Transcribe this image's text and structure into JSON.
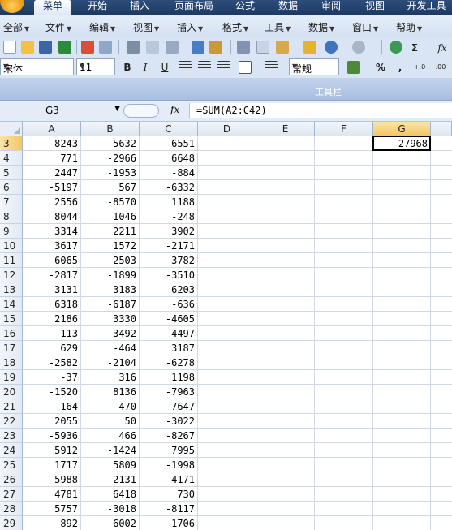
{
  "ribbon_tabs": [
    "菜单",
    "开始",
    "插入",
    "页面布局",
    "公式",
    "数据",
    "审阅",
    "视图",
    "开发工具"
  ],
  "menu_items": [
    "全部",
    "文件",
    "编辑",
    "视图",
    "插入",
    "格式",
    "工具",
    "数据",
    "窗口",
    "帮助"
  ],
  "toolbar": {
    "font_name": "宋体",
    "font_size": "11",
    "number_format": "常规",
    "bold": "B",
    "italic": "I",
    "underline": "U",
    "sum_symbol": "Σ",
    "percent": "%",
    "comma": ",",
    "increase_decimal": "+.0",
    "decrease_decimal": ".00",
    "fx_button": "fx"
  },
  "toolbar_caption": "工具栏",
  "formula_bar": {
    "name_box": "G3",
    "fx_label": "fx",
    "formula": "=SUM(A2:C42)"
  },
  "columns": [
    "A",
    "B",
    "C",
    "D",
    "E",
    "F",
    "G"
  ],
  "selected_column": "G",
  "selected_row": "3",
  "rows": [
    {
      "row": "3",
      "a": "8243",
      "b": "-5632",
      "c": "-6551",
      "g": "27968"
    },
    {
      "row": "4",
      "a": "771",
      "b": "-2966",
      "c": "6648",
      "g": ""
    },
    {
      "row": "5",
      "a": "2447",
      "b": "-1953",
      "c": "-884",
      "g": ""
    },
    {
      "row": "6",
      "a": "-5197",
      "b": "567",
      "c": "-6332",
      "g": ""
    },
    {
      "row": "7",
      "a": "2556",
      "b": "-8570",
      "c": "1188",
      "g": ""
    },
    {
      "row": "8",
      "a": "8044",
      "b": "1046",
      "c": "-248",
      "g": ""
    },
    {
      "row": "9",
      "a": "3314",
      "b": "2211",
      "c": "3902",
      "g": ""
    },
    {
      "row": "10",
      "a": "3617",
      "b": "1572",
      "c": "-2171",
      "g": ""
    },
    {
      "row": "11",
      "a": "6065",
      "b": "-2503",
      "c": "-3782",
      "g": ""
    },
    {
      "row": "12",
      "a": "-2817",
      "b": "-1899",
      "c": "-3510",
      "g": ""
    },
    {
      "row": "13",
      "a": "3131",
      "b": "3183",
      "c": "6203",
      "g": ""
    },
    {
      "row": "14",
      "a": "6318",
      "b": "-6187",
      "c": "-636",
      "g": ""
    },
    {
      "row": "15",
      "a": "2186",
      "b": "3330",
      "c": "-4605",
      "g": ""
    },
    {
      "row": "16",
      "a": "-113",
      "b": "3492",
      "c": "4497",
      "g": ""
    },
    {
      "row": "17",
      "a": "629",
      "b": "-464",
      "c": "3187",
      "g": ""
    },
    {
      "row": "18",
      "a": "-2582",
      "b": "-2104",
      "c": "-6278",
      "g": ""
    },
    {
      "row": "19",
      "a": "-37",
      "b": "316",
      "c": "1198",
      "g": ""
    },
    {
      "row": "20",
      "a": "-1520",
      "b": "8136",
      "c": "-7963",
      "g": ""
    },
    {
      "row": "21",
      "a": "164",
      "b": "470",
      "c": "7647",
      "g": ""
    },
    {
      "row": "22",
      "a": "2055",
      "b": "50",
      "c": "-3022",
      "g": ""
    },
    {
      "row": "23",
      "a": "-5936",
      "b": "466",
      "c": "-8267",
      "g": ""
    },
    {
      "row": "24",
      "a": "5912",
      "b": "-1424",
      "c": "7995",
      "g": ""
    },
    {
      "row": "25",
      "a": "1717",
      "b": "5809",
      "c": "-1998",
      "g": ""
    },
    {
      "row": "26",
      "a": "5988",
      "b": "2131",
      "c": "-4171",
      "g": ""
    },
    {
      "row": "27",
      "a": "4781",
      "b": "6418",
      "c": "730",
      "g": ""
    },
    {
      "row": "28",
      "a": "5757",
      "b": "-3018",
      "c": "-8117",
      "g": ""
    },
    {
      "row": "29",
      "a": "892",
      "b": "6002",
      "c": "-1706",
      "g": ""
    }
  ]
}
